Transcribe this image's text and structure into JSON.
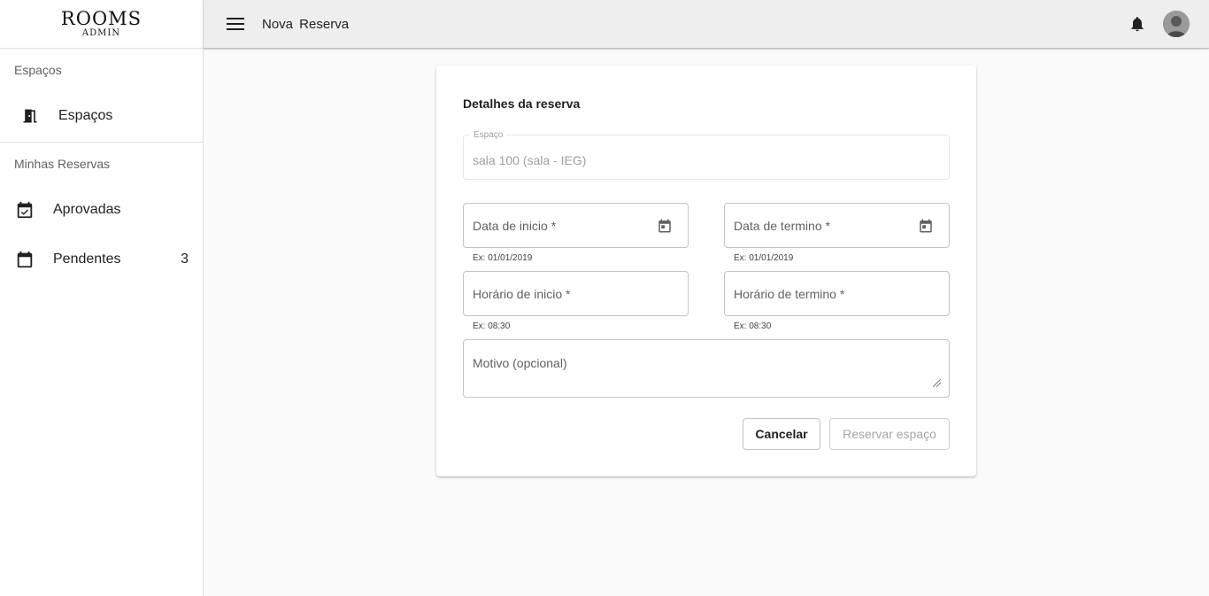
{
  "app": {
    "logo_main": "ROOMS",
    "logo_sub": "ADMIN"
  },
  "header": {
    "title": "Nova Reserva",
    "menu_icon": "menu-icon",
    "notification_icon": "bell-icon"
  },
  "sidebar": {
    "sections": [
      {
        "header": "Espaços",
        "items": [
          {
            "label": "Espaços",
            "icon": "door-icon"
          }
        ]
      },
      {
        "header": "Minhas Reservas",
        "items": [
          {
            "label": "Aprovadas",
            "icon": "calendar-check-icon"
          },
          {
            "label": "Pendentes",
            "icon": "calendar-icon",
            "count": "3"
          }
        ]
      }
    ]
  },
  "form": {
    "title": "Detalhes da reserva",
    "space": {
      "label": "Espaço",
      "value": "sala 100 (sala - IEG)"
    },
    "start_date": {
      "placeholder": "Data de inicio *",
      "helper": "Ex: 01/01/2019"
    },
    "end_date": {
      "placeholder": "Data de termino *",
      "helper": "Ex: 01/01/2019"
    },
    "start_time": {
      "placeholder": "Horário de inicio *",
      "helper": "Ex: 08:30"
    },
    "end_time": {
      "placeholder": "Horário de termino *",
      "helper": "Ex: 08:30"
    },
    "reason": {
      "placeholder": "Motivo (opcional)"
    },
    "cancel_label": "Cancelar",
    "submit_label": "Reservar espaço"
  },
  "colors": {
    "header_bg": "#eeeeee",
    "page_bg": "#fafafa",
    "disabled_text": "#9e9e9e"
  }
}
